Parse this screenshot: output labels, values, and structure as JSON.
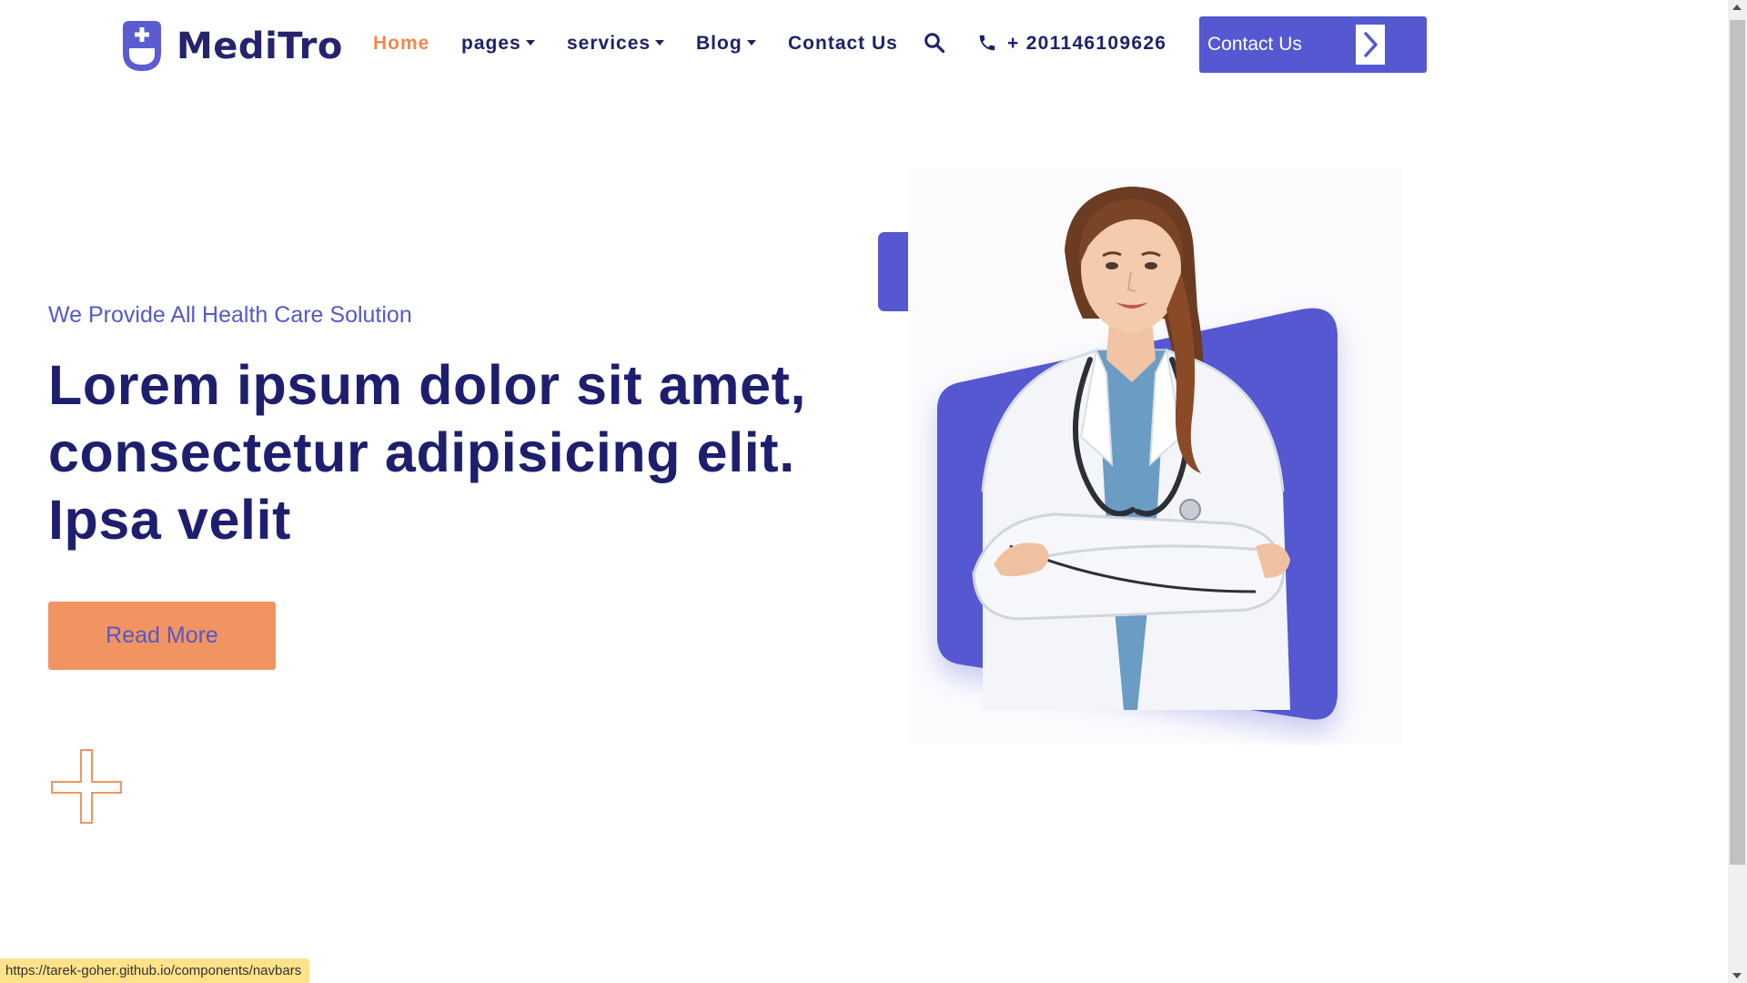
{
  "brand": {
    "name": "MediTro",
    "logo_icon": "medical-shield-icon",
    "color": "#23236e"
  },
  "nav": {
    "items": [
      {
        "label": "Home",
        "active": true,
        "dropdown": false
      },
      {
        "label": "pages",
        "active": false,
        "dropdown": true
      },
      {
        "label": "services",
        "active": false,
        "dropdown": true
      },
      {
        "label": "Blog",
        "active": false,
        "dropdown": true
      },
      {
        "label": "Contact Us",
        "active": false,
        "dropdown": false
      }
    ],
    "search_icon": "search-icon",
    "phone_icon": "phone-icon",
    "phone": "+ 201146109626",
    "cta_label": "Contact Us",
    "cta_icon": "chevron-right-icon"
  },
  "hero": {
    "kicker": "We Provide All Health Care Solution",
    "headline": "Lorem ipsum dolor sit amet, consectetur adipisicing elit. Ipsa velit",
    "button_label": "Read More",
    "image": "doctor-portrait"
  },
  "status_bar": {
    "url": "https://tarek-goher.github.io/components/navbars"
  },
  "colors": {
    "primary": "#5558d1",
    "accent": "#f0894e",
    "button": "#f19462",
    "heading": "#1d1f6e",
    "kicker": "#5558c8"
  }
}
